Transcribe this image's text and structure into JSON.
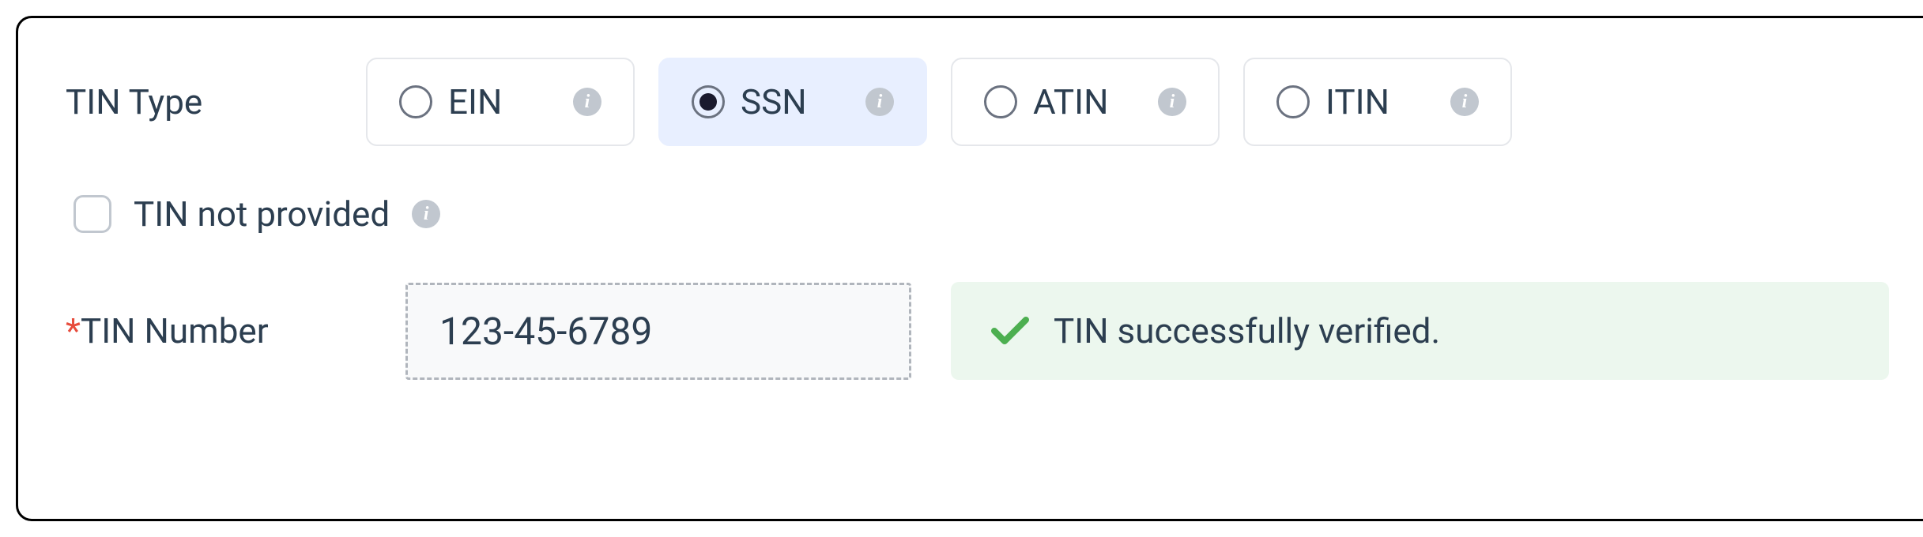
{
  "tinType": {
    "label": "TIN Type",
    "options": [
      {
        "id": "ein",
        "label": "EIN",
        "selected": false
      },
      {
        "id": "ssn",
        "label": "SSN",
        "selected": true
      },
      {
        "id": "atin",
        "label": "ATIN",
        "selected": false
      },
      {
        "id": "itin",
        "label": "ITIN",
        "selected": false
      }
    ]
  },
  "tinNotProvided": {
    "label": "TIN not provided",
    "checked": false
  },
  "tinNumber": {
    "label": "TIN Number",
    "required": true,
    "value": "123-45-6789"
  },
  "verification": {
    "message": "TIN successfully verified.",
    "status": "success"
  }
}
